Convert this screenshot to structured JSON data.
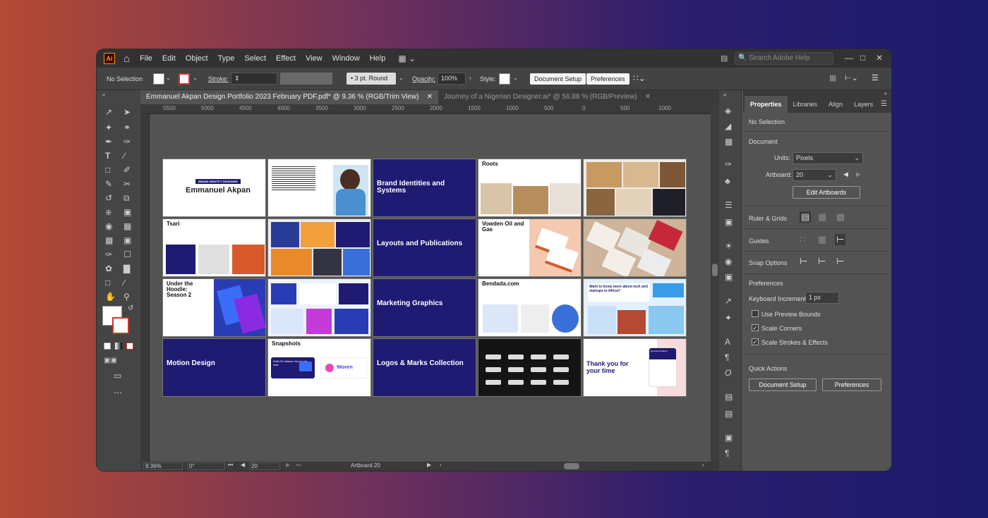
{
  "app": {
    "logo": "Ai"
  },
  "menu": [
    "File",
    "Edit",
    "Object",
    "Type",
    "Select",
    "Effect",
    "View",
    "Window",
    "Help"
  ],
  "search_placeholder": "Search Adobe Help",
  "control": {
    "selection": "No Selection",
    "stroke_label": "Stroke:",
    "brush": "3 pt. Round",
    "opacity_label": "Opacity:",
    "opacity_value": "100%",
    "style_label": "Style:",
    "doc_setup": "Document Setup",
    "preferences": "Preferences"
  },
  "tabs": [
    {
      "label": "Emmanuel Akpan Design Portfolio 2023 February PDF.pdf* @ 9.36 % (RGB/Trim View)",
      "active": true
    },
    {
      "label": "Journey of a Nigerian Designer.ai* @ 56.88 % (RGB/Preview)",
      "active": false
    }
  ],
  "ruler_labels": [
    "5500",
    "5000",
    "4500",
    "4000",
    "3500",
    "3000",
    "2500",
    "2000",
    "1500",
    "1000",
    "500",
    "0",
    "500",
    "1000"
  ],
  "status": {
    "zoom": "9.36%",
    "rotation": "0°",
    "artboard_num": "20",
    "artboard_label": "Artboard 20"
  },
  "panel": {
    "tabs": [
      "Properties",
      "Libraries",
      "Align",
      "Layers"
    ],
    "no_selection": "No Selection",
    "document": "Document",
    "units_label": "Units:",
    "units_value": "Pixels",
    "artboard_label": "Artboard:",
    "artboard_value": "20",
    "edit_artboards": "Edit Artboards",
    "ruler_grids": "Ruler & Grids",
    "guides": "Guides",
    "snap_options": "Snap Options",
    "preferences": "Preferences",
    "keyboard_increment_label": "Keyboard Increment:",
    "keyboard_increment_value": "1 px",
    "use_preview_bounds": "Use Preview Bounds",
    "scale_corners": "Scale Corners",
    "scale_strokes": "Scale Strokes & Effects",
    "quick_actions": "Quick Actions",
    "doc_setup": "Document Setup",
    "prefs_btn": "Preferences"
  },
  "artboards": {
    "a1_badge": "BRAND IDENTITY DESIGNER",
    "a1_name": "Emmanuel Akpan",
    "a3": "Brand Identities and Systems",
    "a4": "Roots",
    "a6": "Tsari",
    "a8": "Layouts and Publications",
    "a9": "Vowden Oil and Gas",
    "a11": "Under the Hoodie: Season 2",
    "a13": "Marketing Graphics",
    "a14": "Bendada.com",
    "a15": "Want to know more about tech and startups in Africa?",
    "a16": "Motion Design",
    "a17": "Snapshots",
    "a17_card": "Hello 50 Indians You've got mail",
    "a17_brand": "Woven",
    "a18": "Logos & Marks Collection",
    "a20": "Thank you for your time",
    "a20_card": "Emmanuel Akpan"
  },
  "colors": {
    "accent": "#1f1a72",
    "chrome_dark": "#323232",
    "chrome": "#535353"
  }
}
